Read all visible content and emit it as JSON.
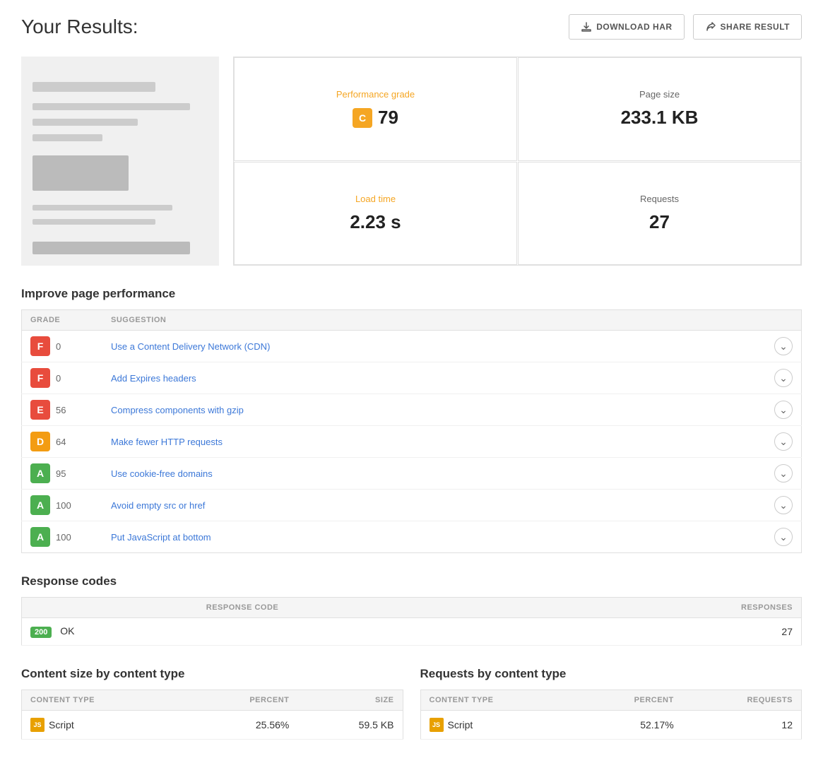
{
  "header": {
    "title": "Your Results:",
    "buttons": {
      "download_har": "DOWNLOAD HAR",
      "share_result": "SHARE RESULT"
    }
  },
  "metrics": {
    "performance_grade": {
      "label": "Performance grade",
      "grade": "C",
      "value": "79"
    },
    "page_size": {
      "label": "Page size",
      "value": "233.1 KB"
    },
    "load_time": {
      "label": "Load time",
      "value": "2.23 s"
    },
    "requests": {
      "label": "Requests",
      "value": "27"
    }
  },
  "improve_section": {
    "title": "Improve page performance",
    "columns": {
      "grade": "GRADE",
      "suggestion": "SUGGESTION"
    },
    "rows": [
      {
        "grade": "F",
        "score": "0",
        "text": "Use a Content Delivery Network (CDN)"
      },
      {
        "grade": "F",
        "score": "0",
        "text": "Add Expires headers"
      },
      {
        "grade": "E",
        "score": "56",
        "text": "Compress components with gzip"
      },
      {
        "grade": "D",
        "score": "64",
        "text": "Make fewer HTTP requests"
      },
      {
        "grade": "A",
        "score": "95",
        "text": "Use cookie-free domains"
      },
      {
        "grade": "A",
        "score": "100",
        "text": "Avoid empty src or href"
      },
      {
        "grade": "A",
        "score": "100",
        "text": "Put JavaScript at bottom"
      }
    ]
  },
  "response_codes_section": {
    "title": "Response codes",
    "columns": {
      "response_code": "RESPONSE CODE",
      "responses": "RESPONSES"
    },
    "rows": [
      {
        "code": "200",
        "label": "OK",
        "count": "27"
      }
    ]
  },
  "content_size_section": {
    "title": "Content size by content type",
    "columns": {
      "content_type": "CONTENT TYPE",
      "percent": "PERCENT",
      "size": "SIZE"
    },
    "rows": [
      {
        "icon": "JS",
        "type": "Script",
        "percent": "25.56%",
        "size": "59.5 KB"
      }
    ]
  },
  "requests_by_type_section": {
    "title": "Requests by content type",
    "columns": {
      "content_type": "CONTENT TYPE",
      "percent": "PERCENT",
      "requests": "REQUESTS"
    },
    "rows": [
      {
        "icon": "JS",
        "type": "Script",
        "percent": "52.17%",
        "requests": "12"
      }
    ]
  }
}
